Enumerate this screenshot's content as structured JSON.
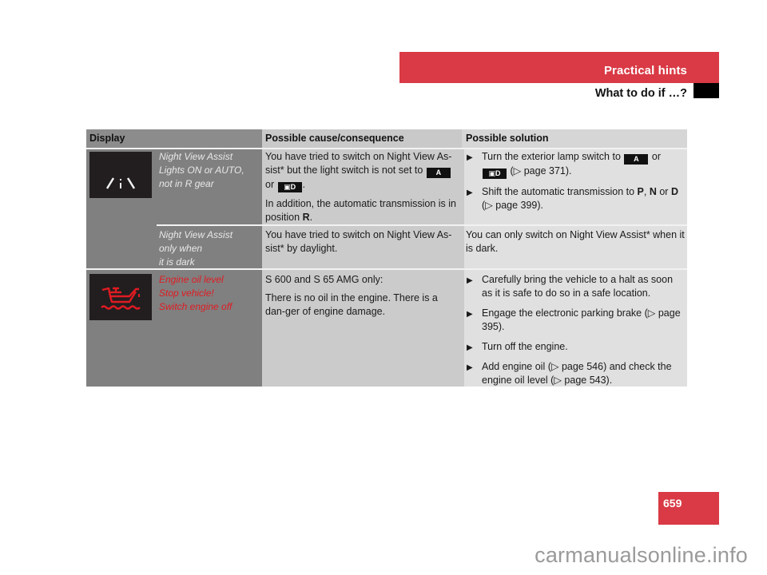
{
  "header": {
    "section_title": "Practical hints",
    "subtitle": "What to do if …?"
  },
  "page_number": "659",
  "watermark": "carmanualsonline.info",
  "colors": {
    "accent_red": "#d93a45",
    "warning_red_text": "#e01b22"
  },
  "table": {
    "columns": [
      "Display",
      "Possible cause/consequence",
      "Possible solution"
    ],
    "rows": [
      {
        "icon": "night-view-icon",
        "message_lines": [
          "Night View Assist",
          "Lights ON or AUTO,",
          "not in R gear"
        ],
        "cause": {
          "p1_part1": "You have tried to switch on Night View As-sist* but the light switch is not set to",
          "p1_sym1": "A",
          "p1_or": "or",
          "p1_sym2": "▣D",
          "p1_end": ".",
          "p2_part1": "In addition, the automatic transmission is in position",
          "p2_bold": "R",
          "p2_end": "."
        },
        "solutions": [
          {
            "text1": "Turn the exterior lamp switch to",
            "sym1": "A",
            "or": "or",
            "sym2": "▣D",
            "ref": "(▷ page 371)."
          },
          {
            "text1": "Shift the automatic transmission to",
            "b1": "P",
            "sep1": ", ",
            "b2": "N",
            "sep2": " or ",
            "b3": "D",
            "ref": "(▷ page 399)."
          }
        ]
      },
      {
        "message_lines": [
          "Night View Assist",
          "only when",
          "it is dark"
        ],
        "cause": "You have tried to switch on Night View As-sist* by daylight.",
        "solution": "You can only switch on Night View Assist* when it is dark."
      },
      {
        "icon": "engine-oil-icon",
        "message_lines": [
          "Engine oil level",
          "Stop vehicle!",
          "Switch engine off"
        ],
        "cause": [
          "S 600 and S 65 AMG only:",
          "There is no oil in the engine. There is a dan-ger of engine damage."
        ],
        "solutions": [
          "Carefully bring the vehicle to a halt as soon as it is safe to do so in a safe location.",
          "Engage the electronic parking brake (▷ page 395).",
          "Turn off the engine.",
          "Add engine oil (▷ page 546) and check the engine oil level (▷ page 543)."
        ]
      }
    ]
  },
  "bullet_glyph": "▶"
}
